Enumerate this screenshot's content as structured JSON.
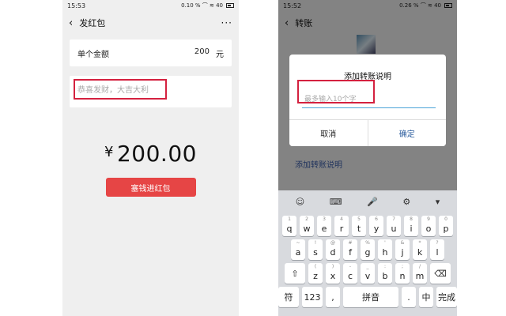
{
  "left": {
    "status": {
      "time": "15:53",
      "right": "0.10 % ⌒ ≋ 40"
    },
    "nav": {
      "title": "发红包",
      "back": "‹",
      "more": "···"
    },
    "amount_row": {
      "label": "单个金额",
      "value": "200",
      "unit": "元"
    },
    "greeting": {
      "placeholder": "恭喜发财，大吉大利"
    },
    "big_amount": {
      "symbol": "¥",
      "value": "200.00"
    },
    "button": {
      "label": "塞钱进红包"
    }
  },
  "right": {
    "status": {
      "time": "15:52",
      "right": "0.26 % ⌒ ≋ 40"
    },
    "nav": {
      "title": "转账",
      "back": "‹"
    },
    "link": {
      "label": "添加转账说明"
    },
    "dialog": {
      "title": "添加转账说明",
      "placeholder": "最多输入10个字",
      "cancel": "取消",
      "ok": "确定"
    },
    "keyboard": {
      "toolbar": [
        "☺",
        "⌨",
        "🎤",
        "⚙",
        "▾"
      ],
      "row1": [
        {
          "main": "q",
          "sub": "1"
        },
        {
          "main": "w",
          "sub": "2"
        },
        {
          "main": "e",
          "sub": "3"
        },
        {
          "main": "r",
          "sub": "4"
        },
        {
          "main": "t",
          "sub": "5"
        },
        {
          "main": "y",
          "sub": "6"
        },
        {
          "main": "u",
          "sub": "7"
        },
        {
          "main": "i",
          "sub": "8"
        },
        {
          "main": "o",
          "sub": "9"
        },
        {
          "main": "p",
          "sub": "0"
        }
      ],
      "row2": [
        {
          "main": "a",
          "sub": "~"
        },
        {
          "main": "s",
          "sub": "!"
        },
        {
          "main": "d",
          "sub": "@"
        },
        {
          "main": "f",
          "sub": "#"
        },
        {
          "main": "g",
          "sub": "%"
        },
        {
          "main": "h",
          "sub": "'"
        },
        {
          "main": "j",
          "sub": "&"
        },
        {
          "main": "k",
          "sub": "*"
        },
        {
          "main": "l",
          "sub": "?"
        }
      ],
      "row3": [
        {
          "main": "z",
          "sub": "("
        },
        {
          "main": "x",
          "sub": ")"
        },
        {
          "main": "c",
          "sub": "-"
        },
        {
          "main": "v",
          "sub": "_"
        },
        {
          "main": "b",
          "sub": ":"
        },
        {
          "main": "n",
          "sub": ";"
        },
        {
          "main": "m",
          "sub": "/"
        }
      ],
      "shift": "⇧",
      "delete": "⌫",
      "bottom": {
        "symbols": "符",
        "numbers": "123",
        "comma": ",",
        "space": "拼音",
        "period": ".",
        "lang": "中",
        "done": "完成"
      }
    }
  }
}
